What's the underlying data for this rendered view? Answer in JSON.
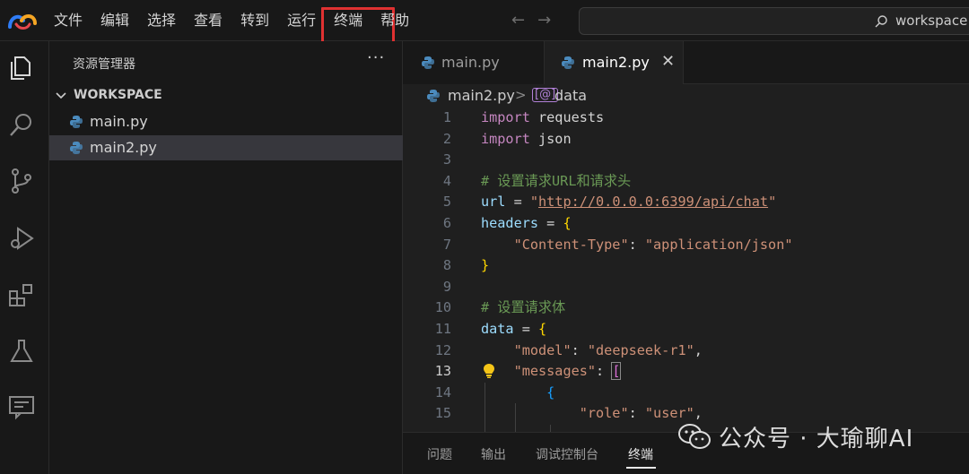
{
  "menu": [
    "文件",
    "编辑",
    "选择",
    "查看",
    "转到",
    "运行",
    "终端",
    "帮助"
  ],
  "nav": {
    "back": "←",
    "forward": "→"
  },
  "search": {
    "icon": "search-icon",
    "text": "workspace"
  },
  "activity_bar": [
    "files-icon",
    "search-icon",
    "source-control-icon",
    "run-debug-icon",
    "extensions-icon",
    "testing-icon",
    "remote-explorer-icon"
  ],
  "sidebar": {
    "title": "资源管理器",
    "more": "···",
    "workspace_chevron": "⌄",
    "workspace_label": "WORKSPACE",
    "files": [
      "main.py",
      "main2.py"
    ]
  },
  "editor": {
    "tabs": [
      {
        "label": "main.py",
        "active": false
      },
      {
        "label": "main2.py",
        "active": true,
        "close": "✕"
      }
    ],
    "breadcrumb": {
      "file": "main2.py",
      "separator": ">",
      "symbol_icon": "[@]",
      "symbol": "data"
    },
    "current_line": 13
  },
  "code_lines": [
    {
      "n": "1",
      "t": [
        [
          "kw",
          "import"
        ],
        [
          "plain",
          " requests"
        ]
      ]
    },
    {
      "n": "2",
      "t": [
        [
          "kw",
          "import"
        ],
        [
          "plain",
          " json"
        ]
      ]
    },
    {
      "n": "3",
      "t": []
    },
    {
      "n": "4",
      "t": [
        [
          "cmt",
          "# 设置请求URL和请求头"
        ]
      ]
    },
    {
      "n": "5",
      "t": [
        [
          "id",
          "url"
        ],
        [
          "plain",
          " = "
        ],
        [
          "str",
          "\""
        ],
        [
          "url",
          "http://0.0.0.0:6399/api/chat"
        ],
        [
          "str",
          "\""
        ]
      ]
    },
    {
      "n": "6",
      "t": [
        [
          "id",
          "headers"
        ],
        [
          "plain",
          " = "
        ],
        [
          "brace",
          "{"
        ]
      ]
    },
    {
      "n": "7",
      "t": [
        [
          "plain",
          "    "
        ],
        [
          "str",
          "\"Content-Type\""
        ],
        [
          "plain",
          ": "
        ],
        [
          "str",
          "\"application/json\""
        ]
      ]
    },
    {
      "n": "8",
      "t": [
        [
          "brace",
          "}"
        ]
      ]
    },
    {
      "n": "9",
      "t": []
    },
    {
      "n": "10",
      "t": [
        [
          "cmt",
          "# 设置请求体"
        ]
      ]
    },
    {
      "n": "11",
      "t": [
        [
          "id",
          "data"
        ],
        [
          "plain",
          " = "
        ],
        [
          "brace",
          "{"
        ]
      ]
    },
    {
      "n": "12",
      "t": [
        [
          "plain",
          "    "
        ],
        [
          "str",
          "\"model\""
        ],
        [
          "plain",
          ": "
        ],
        [
          "str",
          "\"deepseek-r1\""
        ],
        [
          "plain",
          ","
        ]
      ]
    },
    {
      "n": "13",
      "t": [
        [
          "plain",
          "    "
        ],
        [
          "str",
          "\"messages\""
        ],
        [
          "plain",
          ": "
        ],
        [
          "brace2box",
          "["
        ]
      ]
    },
    {
      "n": "14",
      "t": [
        [
          "plain",
          "        "
        ],
        [
          "brace3",
          "{"
        ]
      ]
    },
    {
      "n": "15",
      "t": [
        [
          "plain",
          "            "
        ],
        [
          "str",
          "\"role\""
        ],
        [
          "plain",
          ": "
        ],
        [
          "str",
          "\"user\""
        ],
        [
          "plain",
          ","
        ]
      ]
    }
  ],
  "panel": {
    "tabs": [
      "问题",
      "输出",
      "调试控制台",
      "终端"
    ],
    "active": 3
  },
  "watermark": {
    "icon": "wechat-icon",
    "text": "公众号 · 大瑜聊AI"
  },
  "colors": {
    "highlight_box": "#e03131",
    "keyword": "#c586c0",
    "string": "#ce9178",
    "comment": "#6a9955",
    "python_icon": "#4b8bbe"
  }
}
